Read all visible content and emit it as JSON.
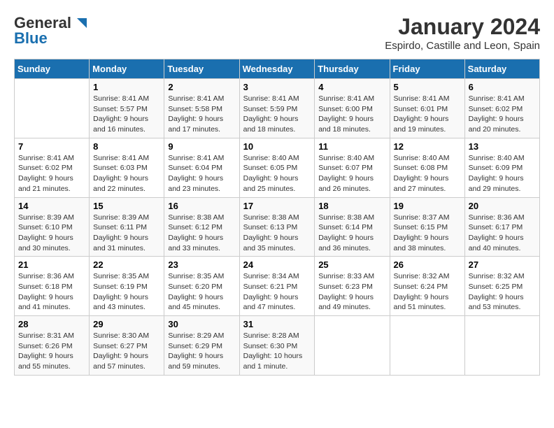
{
  "header": {
    "logo_general": "General",
    "logo_blue": "Blue",
    "month_year": "January 2024",
    "location": "Espirdo, Castille and Leon, Spain"
  },
  "weekdays": [
    "Sunday",
    "Monday",
    "Tuesday",
    "Wednesday",
    "Thursday",
    "Friday",
    "Saturday"
  ],
  "weeks": [
    [
      {
        "day": "",
        "sunrise": "",
        "sunset": "",
        "daylight": ""
      },
      {
        "day": "1",
        "sunrise": "Sunrise: 8:41 AM",
        "sunset": "Sunset: 5:57 PM",
        "daylight": "Daylight: 9 hours and 16 minutes."
      },
      {
        "day": "2",
        "sunrise": "Sunrise: 8:41 AM",
        "sunset": "Sunset: 5:58 PM",
        "daylight": "Daylight: 9 hours and 17 minutes."
      },
      {
        "day": "3",
        "sunrise": "Sunrise: 8:41 AM",
        "sunset": "Sunset: 5:59 PM",
        "daylight": "Daylight: 9 hours and 18 minutes."
      },
      {
        "day": "4",
        "sunrise": "Sunrise: 8:41 AM",
        "sunset": "Sunset: 6:00 PM",
        "daylight": "Daylight: 9 hours and 18 minutes."
      },
      {
        "day": "5",
        "sunrise": "Sunrise: 8:41 AM",
        "sunset": "Sunset: 6:01 PM",
        "daylight": "Daylight: 9 hours and 19 minutes."
      },
      {
        "day": "6",
        "sunrise": "Sunrise: 8:41 AM",
        "sunset": "Sunset: 6:02 PM",
        "daylight": "Daylight: 9 hours and 20 minutes."
      }
    ],
    [
      {
        "day": "7",
        "sunrise": "Sunrise: 8:41 AM",
        "sunset": "Sunset: 6:02 PM",
        "daylight": "Daylight: 9 hours and 21 minutes."
      },
      {
        "day": "8",
        "sunrise": "Sunrise: 8:41 AM",
        "sunset": "Sunset: 6:03 PM",
        "daylight": "Daylight: 9 hours and 22 minutes."
      },
      {
        "day": "9",
        "sunrise": "Sunrise: 8:41 AM",
        "sunset": "Sunset: 6:04 PM",
        "daylight": "Daylight: 9 hours and 23 minutes."
      },
      {
        "day": "10",
        "sunrise": "Sunrise: 8:40 AM",
        "sunset": "Sunset: 6:05 PM",
        "daylight": "Daylight: 9 hours and 25 minutes."
      },
      {
        "day": "11",
        "sunrise": "Sunrise: 8:40 AM",
        "sunset": "Sunset: 6:07 PM",
        "daylight": "Daylight: 9 hours and 26 minutes."
      },
      {
        "day": "12",
        "sunrise": "Sunrise: 8:40 AM",
        "sunset": "Sunset: 6:08 PM",
        "daylight": "Daylight: 9 hours and 27 minutes."
      },
      {
        "day": "13",
        "sunrise": "Sunrise: 8:40 AM",
        "sunset": "Sunset: 6:09 PM",
        "daylight": "Daylight: 9 hours and 29 minutes."
      }
    ],
    [
      {
        "day": "14",
        "sunrise": "Sunrise: 8:39 AM",
        "sunset": "Sunset: 6:10 PM",
        "daylight": "Daylight: 9 hours and 30 minutes."
      },
      {
        "day": "15",
        "sunrise": "Sunrise: 8:39 AM",
        "sunset": "Sunset: 6:11 PM",
        "daylight": "Daylight: 9 hours and 31 minutes."
      },
      {
        "day": "16",
        "sunrise": "Sunrise: 8:38 AM",
        "sunset": "Sunset: 6:12 PM",
        "daylight": "Daylight: 9 hours and 33 minutes."
      },
      {
        "day": "17",
        "sunrise": "Sunrise: 8:38 AM",
        "sunset": "Sunset: 6:13 PM",
        "daylight": "Daylight: 9 hours and 35 minutes."
      },
      {
        "day": "18",
        "sunrise": "Sunrise: 8:38 AM",
        "sunset": "Sunset: 6:14 PM",
        "daylight": "Daylight: 9 hours and 36 minutes."
      },
      {
        "day": "19",
        "sunrise": "Sunrise: 8:37 AM",
        "sunset": "Sunset: 6:15 PM",
        "daylight": "Daylight: 9 hours and 38 minutes."
      },
      {
        "day": "20",
        "sunrise": "Sunrise: 8:36 AM",
        "sunset": "Sunset: 6:17 PM",
        "daylight": "Daylight: 9 hours and 40 minutes."
      }
    ],
    [
      {
        "day": "21",
        "sunrise": "Sunrise: 8:36 AM",
        "sunset": "Sunset: 6:18 PM",
        "daylight": "Daylight: 9 hours and 41 minutes."
      },
      {
        "day": "22",
        "sunrise": "Sunrise: 8:35 AM",
        "sunset": "Sunset: 6:19 PM",
        "daylight": "Daylight: 9 hours and 43 minutes."
      },
      {
        "day": "23",
        "sunrise": "Sunrise: 8:35 AM",
        "sunset": "Sunset: 6:20 PM",
        "daylight": "Daylight: 9 hours and 45 minutes."
      },
      {
        "day": "24",
        "sunrise": "Sunrise: 8:34 AM",
        "sunset": "Sunset: 6:21 PM",
        "daylight": "Daylight: 9 hours and 47 minutes."
      },
      {
        "day": "25",
        "sunrise": "Sunrise: 8:33 AM",
        "sunset": "Sunset: 6:23 PM",
        "daylight": "Daylight: 9 hours and 49 minutes."
      },
      {
        "day": "26",
        "sunrise": "Sunrise: 8:32 AM",
        "sunset": "Sunset: 6:24 PM",
        "daylight": "Daylight: 9 hours and 51 minutes."
      },
      {
        "day": "27",
        "sunrise": "Sunrise: 8:32 AM",
        "sunset": "Sunset: 6:25 PM",
        "daylight": "Daylight: 9 hours and 53 minutes."
      }
    ],
    [
      {
        "day": "28",
        "sunrise": "Sunrise: 8:31 AM",
        "sunset": "Sunset: 6:26 PM",
        "daylight": "Daylight: 9 hours and 55 minutes."
      },
      {
        "day": "29",
        "sunrise": "Sunrise: 8:30 AM",
        "sunset": "Sunset: 6:27 PM",
        "daylight": "Daylight: 9 hours and 57 minutes."
      },
      {
        "day": "30",
        "sunrise": "Sunrise: 8:29 AM",
        "sunset": "Sunset: 6:29 PM",
        "daylight": "Daylight: 9 hours and 59 minutes."
      },
      {
        "day": "31",
        "sunrise": "Sunrise: 8:28 AM",
        "sunset": "Sunset: 6:30 PM",
        "daylight": "Daylight: 10 hours and 1 minute."
      },
      {
        "day": "",
        "sunrise": "",
        "sunset": "",
        "daylight": ""
      },
      {
        "day": "",
        "sunrise": "",
        "sunset": "",
        "daylight": ""
      },
      {
        "day": "",
        "sunrise": "",
        "sunset": "",
        "daylight": ""
      }
    ]
  ]
}
